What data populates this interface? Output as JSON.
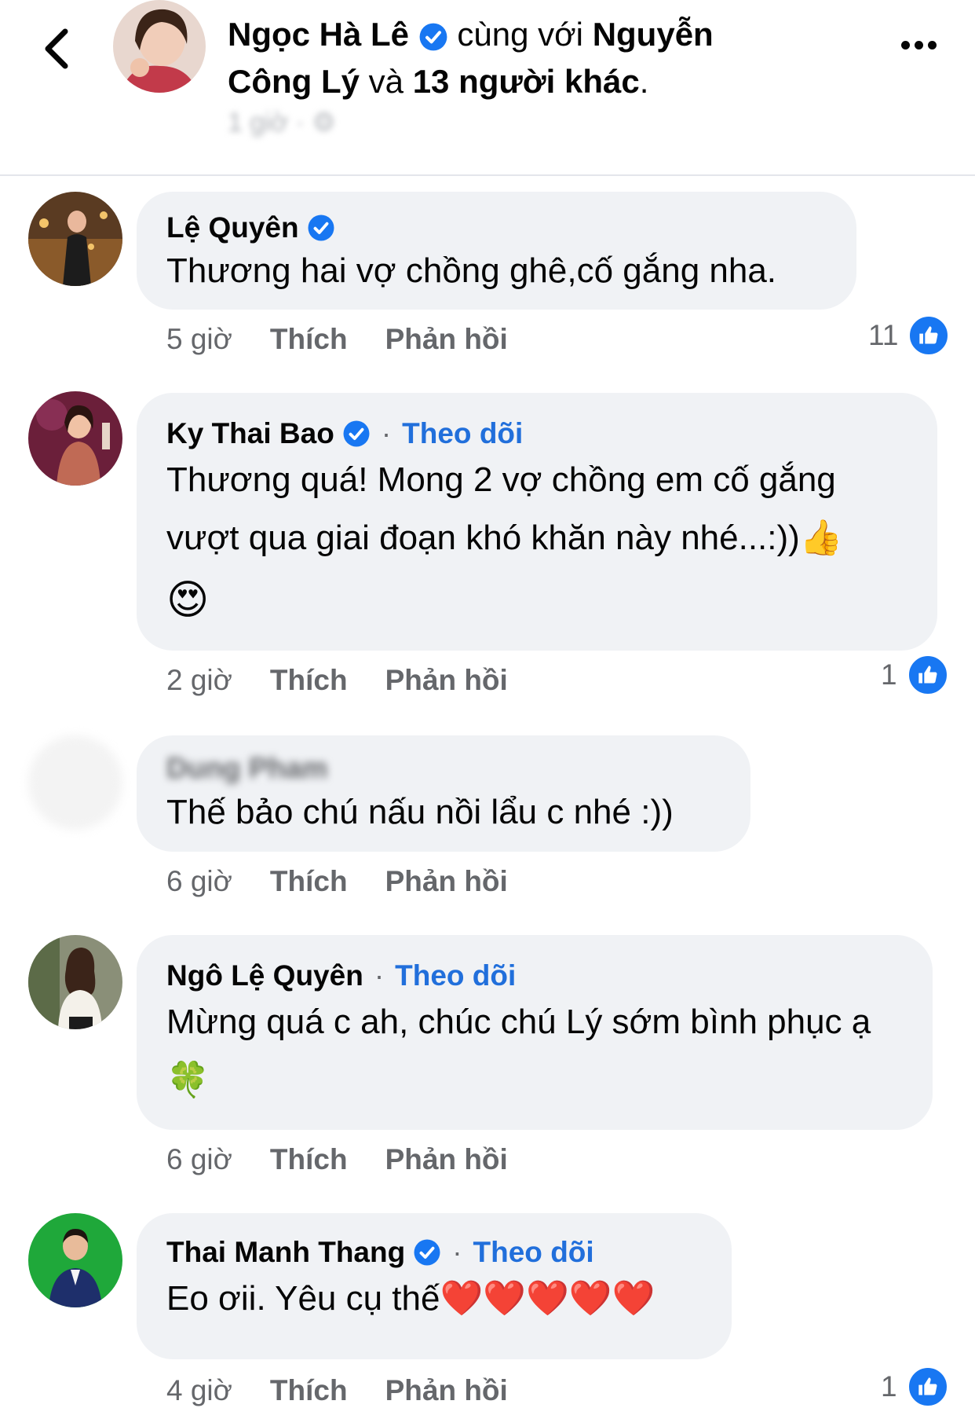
{
  "header": {
    "author": "Ngọc Hà Lê",
    "with_text": "cùng với",
    "tagged": "Nguyễn Công Lý",
    "and_text": "và",
    "others": "13 người khác",
    "period": ".",
    "sub": "1 giờ · ⚙"
  },
  "comments": [
    {
      "name": "Lệ Quyên",
      "verified": true,
      "follow": "",
      "text": "Thương hai vợ chồng ghê,cố gắng nha.",
      "time": "5 giờ",
      "like_label": "Thích",
      "reply_label": "Phản hồi",
      "likes": "11"
    },
    {
      "name": "Ky Thai Bao",
      "verified": true,
      "follow": "Theo dõi",
      "text": "Thương quá! Mong 2 vợ chồng em cố gắng vượt qua giai đoạn khó khăn này nhé...:))",
      "emoji_inline": "👍",
      "emoji_line": "😍",
      "time": "2 giờ",
      "like_label": "Thích",
      "reply_label": "Phản hồi",
      "likes": "1"
    },
    {
      "name": "Dung Pham",
      "verified": false,
      "follow": "",
      "text": "Thế bảo chú nấu nồi lẩu c nhé :))",
      "time": "6 giờ",
      "like_label": "Thích",
      "reply_label": "Phản hồi",
      "likes": ""
    },
    {
      "name": "Ngô Lệ Quyên",
      "verified": false,
      "follow": "Theo dõi",
      "text": "Mừng quá c ah, chúc chú Lý sớm bình phục ạ",
      "emoji_inline": "🍀",
      "time": "6 giờ",
      "like_label": "Thích",
      "reply_label": "Phản hồi",
      "likes": ""
    },
    {
      "name": "Thai Manh Thang",
      "verified": true,
      "follow": "Theo dõi",
      "text": "Eo ơii. Yêu cụ thế",
      "emoji_inline": "❤️❤️❤️❤️❤️",
      "time": "4 giờ",
      "like_label": "Thích",
      "reply_label": "Phản hồi",
      "likes": "1"
    }
  ],
  "colors": {
    "bubble": "#f0f2f5",
    "link": "#216fdb",
    "meta": "#65676b",
    "like": "#1877f2",
    "verified": "#1877f2"
  }
}
